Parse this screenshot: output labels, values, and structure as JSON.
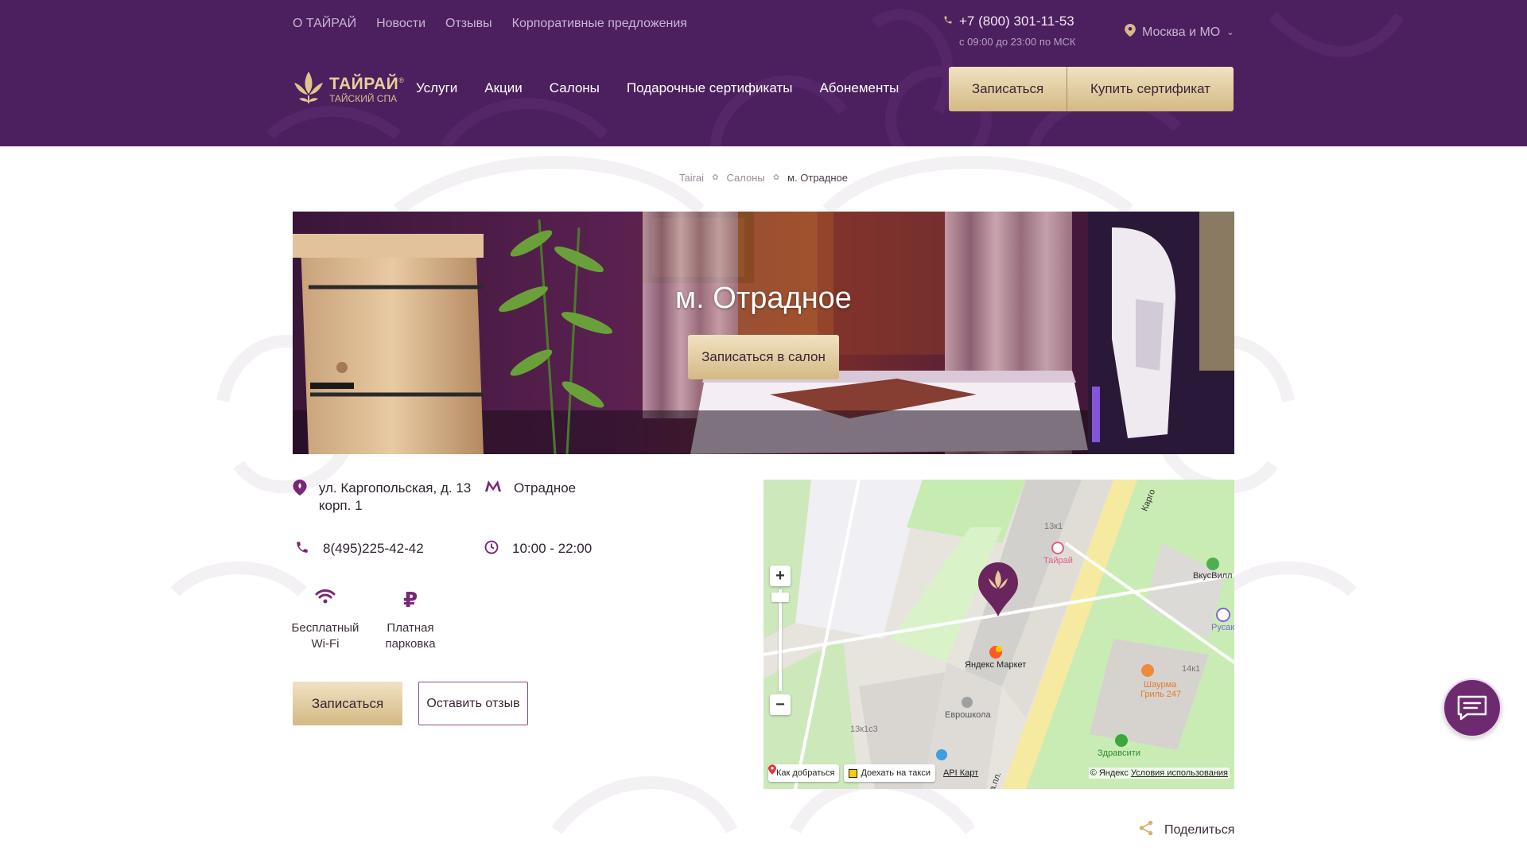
{
  "header": {
    "topnav": [
      "О ТАЙРАЙ",
      "Новости",
      "Отзывы",
      "Корпоративные предложения"
    ],
    "phone": "+7 (800) 301-11-53",
    "hours": "с 09:00 до 23:00 по МСК",
    "region": "Москва и МО",
    "logo": {
      "main": "ТАЙРАЙ",
      "sub": "ТАЙСКИЙ СПА",
      "mark": "®"
    },
    "mainnav": [
      "Услуги",
      "Акции",
      "Салоны",
      "Подарочные сертификаты",
      "Абонементы"
    ],
    "btn_book": "Записаться",
    "btn_cert": "Купить сертификат",
    "bg_color": "#4c1f5e",
    "accent_gold": "#d4b984"
  },
  "breadcrumb": {
    "items": [
      "Tairai",
      "Салоны"
    ],
    "current": "м. Отрадное"
  },
  "hero": {
    "title": "м. Отрадное",
    "button": "Записаться в салон"
  },
  "info": {
    "address": "ул. Каргопольская, д. 13 корп. 1",
    "metro": "Отрадное",
    "phone": "8(495)225-42-42",
    "hours": "10:00 - 22:00",
    "amenities": [
      {
        "icon": "wifi-icon",
        "label": "Бесплатный Wi-Fi"
      },
      {
        "icon": "ruble-icon",
        "label": "Платная парковка"
      }
    ],
    "btn_book": "Записаться",
    "btn_review": "Оставить отзыв"
  },
  "map": {
    "labels": {
      "b1": "13к1",
      "tairai": "Тайрай",
      "vkusvill": "ВкусВилл",
      "rusak": "Русак",
      "market": "Яндекс Маркет",
      "shaurma1": "Шаурма",
      "shaurma2": "Гриль 247",
      "b2": "14к1",
      "evroshkola": "Еврошкола",
      "b3": "13к1с3",
      "zdravsiti": "Здравсити",
      "street": "Карго",
      "street2": "ка.пл."
    },
    "route_btn": "Как добраться",
    "taxi_btn": "Доехать на такси",
    "api": "API Карт",
    "copyright": "© Яндекс",
    "terms": "Условия использования"
  },
  "share": "Поделиться",
  "chat_icon": "chat-icon"
}
